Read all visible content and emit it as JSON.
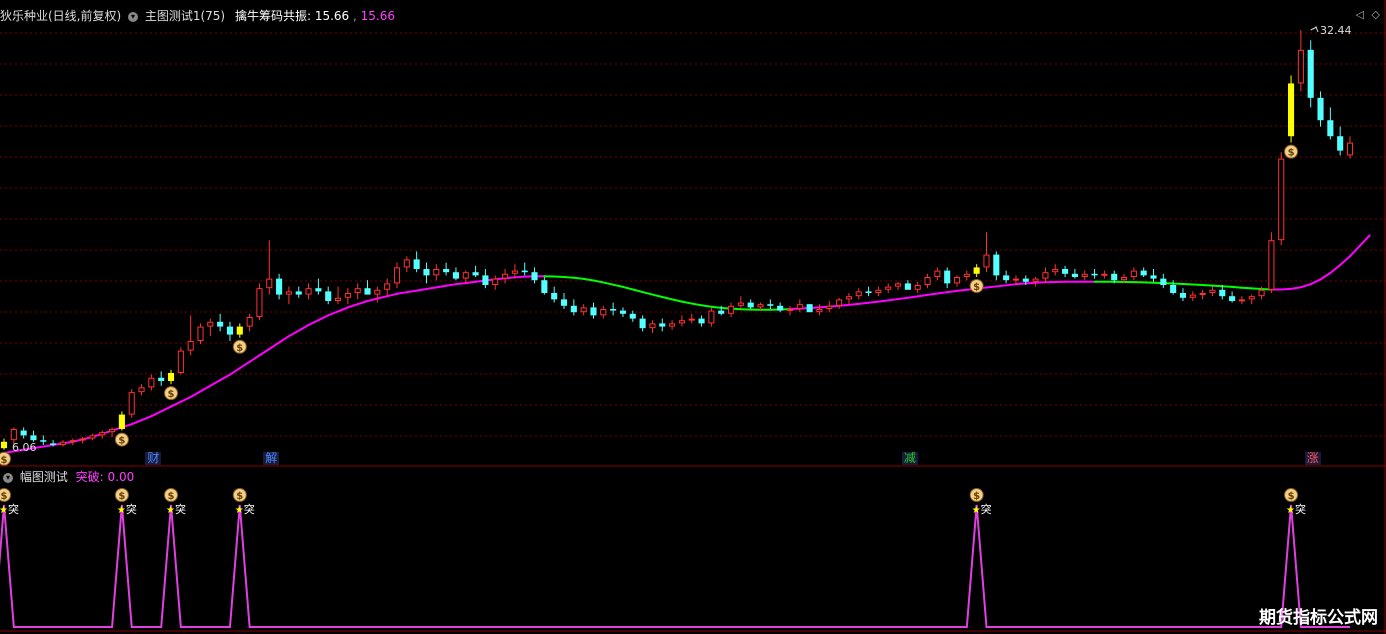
{
  "main_panel": {
    "stock_title": "狄乐种业(日线,前复权)",
    "indicator_name": "主图测试1(75)",
    "indicator_line_label": "擒牛筹码共振:",
    "indicator_value_white": "15.66",
    "indicator_value_magenta": "15.66",
    "high_price_label": "32.44",
    "low_price_label": "6.06",
    "event_labels": [
      {
        "text": "财",
        "color": "#4488ff",
        "x_index": 5
      },
      {
        "text": "解",
        "color": "#4488ff",
        "x_index": 9
      },
      {
        "text": "减",
        "color": "#22cc22",
        "x_index": 31
      },
      {
        "text": "涨",
        "color": "#ff5555",
        "x_index": 44
      }
    ]
  },
  "sub_panel": {
    "indicator_name": "幅图测试",
    "line_label": "突破:",
    "line_value": "0.00",
    "signal_text": "突",
    "signal_star": "★"
  },
  "watermark": "期货指标公式网",
  "colors": {
    "up": "#ff3232",
    "down": "#54ffff",
    "signal_bar": "#ffff00",
    "ma_up": "#ff00ff",
    "ma_down": "#00ff00",
    "grid": "#7a0000",
    "signal_line": "#e040e0"
  },
  "chart_data": {
    "type": "candlestick",
    "price_range": [
      6.06,
      32.44
    ],
    "candles": [
      [
        6.3,
        6.9,
        6.2,
        6.7
      ],
      [
        6.8,
        7.6,
        6.5,
        7.5
      ],
      [
        7.4,
        7.6,
        6.9,
        7.1
      ],
      [
        7.1,
        7.4,
        6.7,
        6.8
      ],
      [
        6.8,
        7.1,
        6.5,
        6.7
      ],
      [
        6.6,
        6.8,
        6.4,
        6.5
      ],
      [
        6.5,
        6.8,
        6.4,
        6.7
      ],
      [
        6.7,
        6.9,
        6.5,
        6.8
      ],
      [
        6.8,
        7.0,
        6.6,
        6.9
      ],
      [
        6.9,
        7.2,
        6.8,
        7.1
      ],
      [
        7.1,
        7.4,
        6.9,
        7.3
      ],
      [
        7.3,
        7.6,
        7.0,
        7.5
      ],
      [
        7.5,
        8.6,
        7.4,
        8.4
      ],
      [
        8.4,
        10.0,
        8.2,
        9.8
      ],
      [
        9.8,
        10.3,
        9.6,
        10.1
      ],
      [
        10.1,
        10.9,
        9.9,
        10.7
      ],
      [
        10.7,
        11.1,
        10.2,
        10.5
      ],
      [
        10.5,
        11.2,
        10.3,
        11.0
      ],
      [
        11.0,
        12.6,
        10.9,
        12.4
      ],
      [
        12.4,
        14.6,
        12.1,
        13.0
      ],
      [
        13.0,
        14.1,
        12.8,
        13.9
      ],
      [
        13.9,
        14.4,
        13.3,
        14.2
      ],
      [
        14.2,
        14.7,
        13.6,
        13.9
      ],
      [
        13.9,
        14.2,
        13.0,
        13.4
      ],
      [
        13.4,
        14.1,
        13.2,
        13.9
      ],
      [
        13.9,
        14.7,
        13.6,
        14.5
      ],
      [
        14.5,
        16.6,
        14.3,
        16.3
      ],
      [
        16.3,
        19.3,
        15.9,
        16.9
      ],
      [
        16.9,
        17.2,
        15.6,
        15.9
      ],
      [
        15.9,
        16.4,
        15.3,
        16.1
      ],
      [
        16.1,
        16.4,
        15.7,
        15.9
      ],
      [
        15.9,
        16.6,
        15.6,
        16.3
      ],
      [
        16.3,
        16.9,
        15.9,
        16.1
      ],
      [
        16.1,
        16.4,
        15.3,
        15.5
      ],
      [
        15.5,
        16.4,
        15.3,
        15.7
      ],
      [
        15.7,
        16.3,
        15.3,
        16.0
      ],
      [
        16.0,
        16.6,
        15.6,
        16.3
      ],
      [
        16.3,
        16.8,
        15.9,
        15.9
      ],
      [
        15.9,
        16.4,
        15.4,
        16.2
      ],
      [
        16.2,
        16.9,
        15.8,
        16.6
      ],
      [
        16.6,
        17.9,
        16.3,
        17.6
      ],
      [
        17.6,
        18.3,
        17.3,
        18.1
      ],
      [
        18.1,
        18.6,
        17.3,
        17.5
      ],
      [
        17.5,
        17.9,
        16.6,
        17.1
      ],
      [
        17.1,
        17.8,
        16.8,
        17.5
      ],
      [
        17.5,
        17.9,
        17.1,
        17.3
      ],
      [
        17.3,
        17.6,
        16.8,
        16.9
      ],
      [
        16.9,
        17.4,
        16.6,
        17.3
      ],
      [
        17.3,
        17.7,
        17.0,
        17.1
      ],
      [
        17.1,
        17.5,
        16.3,
        16.5
      ],
      [
        16.5,
        17.1,
        16.2,
        16.9
      ],
      [
        16.9,
        17.5,
        16.6,
        17.2
      ],
      [
        17.2,
        17.8,
        16.9,
        17.4
      ],
      [
        17.4,
        17.9,
        17.1,
        17.3
      ],
      [
        17.3,
        17.6,
        16.6,
        16.8
      ],
      [
        16.8,
        17.0,
        15.9,
        16.0
      ],
      [
        16.0,
        16.4,
        15.4,
        15.6
      ],
      [
        15.6,
        16.0,
        15.0,
        15.2
      ],
      [
        15.2,
        15.6,
        14.6,
        14.8
      ],
      [
        14.8,
        15.3,
        14.6,
        15.1
      ],
      [
        15.1,
        15.4,
        14.4,
        14.6
      ],
      [
        14.6,
        15.2,
        14.4,
        15.0
      ],
      [
        15.0,
        15.4,
        14.6,
        14.9
      ],
      [
        14.9,
        15.1,
        14.5,
        14.7
      ],
      [
        14.7,
        14.9,
        14.2,
        14.4
      ],
      [
        14.4,
        14.6,
        13.6,
        13.8
      ],
      [
        13.8,
        14.3,
        13.5,
        14.1
      ],
      [
        14.1,
        14.4,
        13.6,
        13.9
      ],
      [
        13.9,
        14.3,
        13.7,
        14.1
      ],
      [
        14.1,
        14.6,
        13.9,
        14.3
      ],
      [
        14.3,
        14.7,
        14.1,
        14.4
      ],
      [
        14.4,
        14.6,
        13.9,
        14.1
      ],
      [
        14.1,
        15.1,
        13.9,
        14.9
      ],
      [
        14.9,
        15.2,
        14.6,
        14.7
      ],
      [
        14.7,
        15.4,
        14.5,
        15.2
      ],
      [
        15.2,
        15.8,
        15.0,
        15.4
      ],
      [
        15.4,
        15.6,
        15.0,
        15.1
      ],
      [
        15.1,
        15.4,
        14.9,
        15.3
      ],
      [
        15.3,
        15.6,
        15.0,
        15.2
      ],
      [
        15.2,
        15.4,
        14.8,
        14.9
      ],
      [
        14.9,
        15.2,
        14.6,
        15.0
      ],
      [
        15.0,
        15.6,
        14.8,
        15.3
      ],
      [
        15.3,
        15.3,
        14.9,
        14.8
      ],
      [
        14.8,
        15.3,
        14.6,
        15.0
      ],
      [
        15.0,
        15.5,
        14.8,
        15.2
      ],
      [
        15.2,
        15.7,
        15.0,
        15.6
      ],
      [
        15.6,
        16.0,
        15.3,
        15.8
      ],
      [
        15.8,
        16.3,
        15.6,
        16.1
      ],
      [
        16.1,
        16.4,
        15.8,
        16.0
      ],
      [
        16.0,
        16.4,
        15.8,
        16.2
      ],
      [
        16.2,
        16.6,
        16.0,
        16.4
      ],
      [
        16.4,
        16.7,
        16.2,
        16.6
      ],
      [
        16.6,
        16.8,
        16.3,
        16.2
      ],
      [
        16.2,
        16.7,
        16.0,
        16.5
      ],
      [
        16.5,
        17.2,
        16.3,
        17.0
      ],
      [
        17.0,
        17.6,
        16.8,
        17.4
      ],
      [
        17.4,
        17.6,
        16.3,
        16.6
      ],
      [
        16.6,
        17.1,
        16.4,
        17.0
      ],
      [
        17.0,
        17.4,
        16.8,
        17.2
      ],
      [
        17.2,
        17.8,
        17.0,
        17.6
      ],
      [
        17.6,
        19.8,
        17.3,
        18.4
      ],
      [
        18.4,
        18.6,
        16.8,
        17.1
      ],
      [
        17.1,
        17.4,
        16.6,
        16.8
      ],
      [
        16.8,
        17.1,
        16.5,
        16.9
      ],
      [
        16.9,
        17.1,
        16.5,
        16.7
      ],
      [
        16.7,
        17.0,
        16.4,
        16.9
      ],
      [
        16.9,
        17.6,
        16.6,
        17.3
      ],
      [
        17.3,
        17.8,
        17.1,
        17.5
      ],
      [
        17.5,
        17.7,
        17.0,
        17.2
      ],
      [
        17.2,
        17.5,
        16.9,
        17.0
      ],
      [
        17.0,
        17.4,
        16.8,
        17.2
      ],
      [
        17.2,
        17.5,
        16.9,
        17.1
      ],
      [
        17.1,
        17.4,
        16.9,
        17.2
      ],
      [
        17.2,
        17.4,
        16.6,
        16.8
      ],
      [
        16.8,
        17.2,
        16.6,
        17.0
      ],
      [
        17.0,
        17.6,
        16.8,
        17.4
      ],
      [
        17.4,
        17.6,
        17.0,
        17.1
      ],
      [
        17.1,
        17.5,
        16.7,
        16.9
      ],
      [
        16.9,
        17.2,
        16.3,
        16.5
      ],
      [
        16.5,
        16.8,
        15.9,
        16.0
      ],
      [
        16.0,
        16.3,
        15.5,
        15.7
      ],
      [
        15.7,
        16.1,
        15.5,
        15.9
      ],
      [
        15.9,
        16.2,
        15.6,
        16.0
      ],
      [
        16.0,
        16.4,
        15.8,
        16.2
      ],
      [
        16.2,
        16.5,
        15.6,
        15.8
      ],
      [
        15.8,
        16.1,
        15.4,
        15.5
      ],
      [
        15.5,
        15.8,
        15.3,
        15.6
      ],
      [
        15.6,
        15.9,
        15.3,
        15.8
      ],
      [
        15.8,
        16.4,
        15.6,
        16.2
      ],
      [
        16.2,
        19.8,
        16.0,
        19.3
      ],
      [
        19.3,
        24.8,
        19.0,
        24.4
      ],
      [
        25.8,
        29.6,
        25.4,
        29.1
      ],
      [
        29.1,
        32.44,
        28.6,
        31.2
      ],
      [
        31.2,
        31.8,
        27.6,
        28.2
      ],
      [
        28.2,
        28.6,
        26.4,
        26.8
      ],
      [
        26.8,
        27.6,
        25.6,
        25.8
      ],
      [
        25.8,
        26.4,
        24.6,
        24.9
      ],
      [
        24.6,
        25.8,
        24.4,
        25.4
      ]
    ],
    "signal_bar_indices": [
      0,
      12,
      17,
      24,
      99,
      131
    ],
    "ma_line": [
      6.0,
      6.1,
      6.2,
      6.3,
      6.4,
      6.5,
      6.6,
      6.7,
      6.85,
      7.0,
      7.2,
      7.4,
      7.6,
      7.8,
      8.05,
      8.3,
      8.6,
      8.9,
      9.2,
      9.5,
      9.85,
      10.2,
      10.55,
      10.9,
      11.3,
      11.7,
      12.1,
      12.5,
      12.9,
      13.3,
      13.65,
      14.0,
      14.3,
      14.6,
      14.85,
      15.1,
      15.3,
      15.5,
      15.65,
      15.8,
      15.95,
      16.05,
      16.15,
      16.25,
      16.35,
      16.45,
      16.55,
      16.62,
      16.7,
      16.78,
      16.85,
      16.92,
      16.98,
      17.02,
      17.05,
      17.05,
      17.03,
      17.0,
      16.95,
      16.88,
      16.78,
      16.66,
      16.52,
      16.38,
      16.22,
      16.06,
      15.9,
      15.75,
      15.6,
      15.46,
      15.34,
      15.23,
      15.14,
      15.07,
      15.02,
      14.98,
      14.96,
      14.95,
      14.95,
      14.97,
      14.99,
      15.02,
      15.06,
      15.1,
      15.15,
      15.2,
      15.26,
      15.32,
      15.39,
      15.46,
      15.54,
      15.62,
      15.7,
      15.79,
      15.88,
      15.97,
      16.05,
      16.13,
      16.2,
      16.27,
      16.34,
      16.41,
      16.48,
      16.55,
      16.6,
      16.64,
      16.67,
      16.69,
      16.7,
      16.7,
      16.7,
      16.7,
      16.7,
      16.7,
      16.69,
      16.68,
      16.66,
      16.64,
      16.62,
      16.59,
      16.56,
      16.53,
      16.5,
      16.46,
      16.42,
      16.38,
      16.33,
      16.29,
      16.25,
      16.22,
      16.22,
      16.26,
      16.36,
      16.55,
      16.85,
      17.25,
      17.75,
      18.3,
      18.95,
      19.6
    ],
    "ma_green_segments": [
      [
        55,
        80
      ],
      [
        111,
        129
      ]
    ],
    "breakout_signal_indices": [
      0,
      12,
      17,
      24,
      99,
      131
    ],
    "breakout_value_range": [
      0,
      1
    ]
  }
}
